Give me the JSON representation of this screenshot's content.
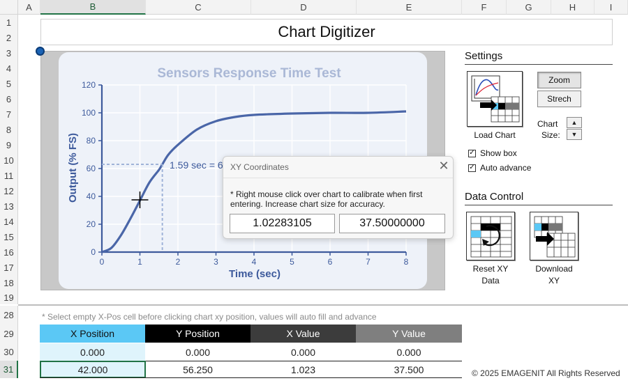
{
  "sheet": {
    "columns": [
      "A",
      "B",
      "C",
      "D",
      "E",
      "F",
      "G",
      "H",
      "I"
    ],
    "rows": [
      "1",
      "2",
      "3",
      "4",
      "5",
      "6",
      "7",
      "8",
      "9",
      "10",
      "11",
      "12",
      "13",
      "14",
      "15",
      "16",
      "17",
      "18",
      "19",
      "28",
      "29",
      "30",
      "31"
    ],
    "selected_column": "B",
    "selected_row": "31"
  },
  "title": "Chart Digitizer",
  "chart": {
    "heading": "Sensors Response Time Test",
    "annotation": "1.59 sec = 6",
    "colors": {
      "curve": "#4a66a8",
      "heading": "#aab8d6",
      "axis_text": "#3d5a9c",
      "dash": "#9fb3d8"
    }
  },
  "chart_data": {
    "type": "line",
    "title": "Sensors Response Time Test",
    "xlabel": "Time (sec)",
    "ylabel": "Output (% FS)",
    "xlim": [
      0,
      8
    ],
    "ylim": [
      0,
      120
    ],
    "x_ticks": [
      "0",
      "1",
      "2",
      "3",
      "4",
      "5",
      "6",
      "7",
      "8"
    ],
    "y_ticks": [
      "0",
      "20",
      "40",
      "60",
      "80",
      "100",
      "120"
    ],
    "grid": true,
    "series": [
      {
        "x": [
          0,
          0.25,
          0.5,
          0.75,
          1.0,
          1.25,
          1.5,
          1.59,
          1.75,
          2.0,
          2.5,
          3.0,
          3.5,
          4.0,
          5.0,
          6.0,
          7.0,
          8.0
        ],
        "values": [
          0,
          3,
          12,
          24,
          37,
          50,
          59,
          63,
          70,
          77,
          88,
          94,
          97,
          98.5,
          99.5,
          100,
          100,
          101
        ]
      }
    ],
    "marker_point": {
      "x": 1.59,
      "y": 63
    },
    "cursor_point": {
      "x": 1.0,
      "y": 37.5
    }
  },
  "dialog": {
    "title": "XY Coordinates",
    "close_glyph": "✕",
    "message": "* Right mouse click over chart to calibrate when first entering. Increase chart size for accuracy.",
    "x_value": "1.02283105",
    "y_value": "37.50000000"
  },
  "settings": {
    "label": "Settings",
    "load_chart_label": "Load Chart",
    "zoom_label": "Zoom",
    "stretch_label": "Strech",
    "chart_size_label_1": "Chart",
    "chart_size_label_2": "Size:",
    "up_glyph": "▲",
    "down_glyph": "▼",
    "show_box_label": "Show box",
    "show_box_checked": true,
    "auto_advance_label": "Auto advance",
    "auto_advance_checked": true,
    "check_glyph": "✓"
  },
  "data_control": {
    "label": "Data Control",
    "reset_label_1": "Reset XY",
    "reset_label_2": "Data",
    "download_label_1": "Download",
    "download_label_2": "XY"
  },
  "hint": "* Select empty X-Pos cell before clicking chart xy position, values will auto fill and advance",
  "table": {
    "headers": [
      "X Position",
      "Y Position",
      "X Value",
      "Y Value"
    ],
    "rows": [
      [
        "0.000",
        "0.000",
        "0.000",
        "0.000"
      ],
      [
        "42.000",
        "56.250",
        "1.023",
        "37.500"
      ]
    ],
    "header_colors": [
      "#5bc8f5",
      "#000000",
      "#3c3c3c",
      "#7f7f7f"
    ]
  },
  "copyright": "© 2025 EMAGENIT All Rights Reserved"
}
